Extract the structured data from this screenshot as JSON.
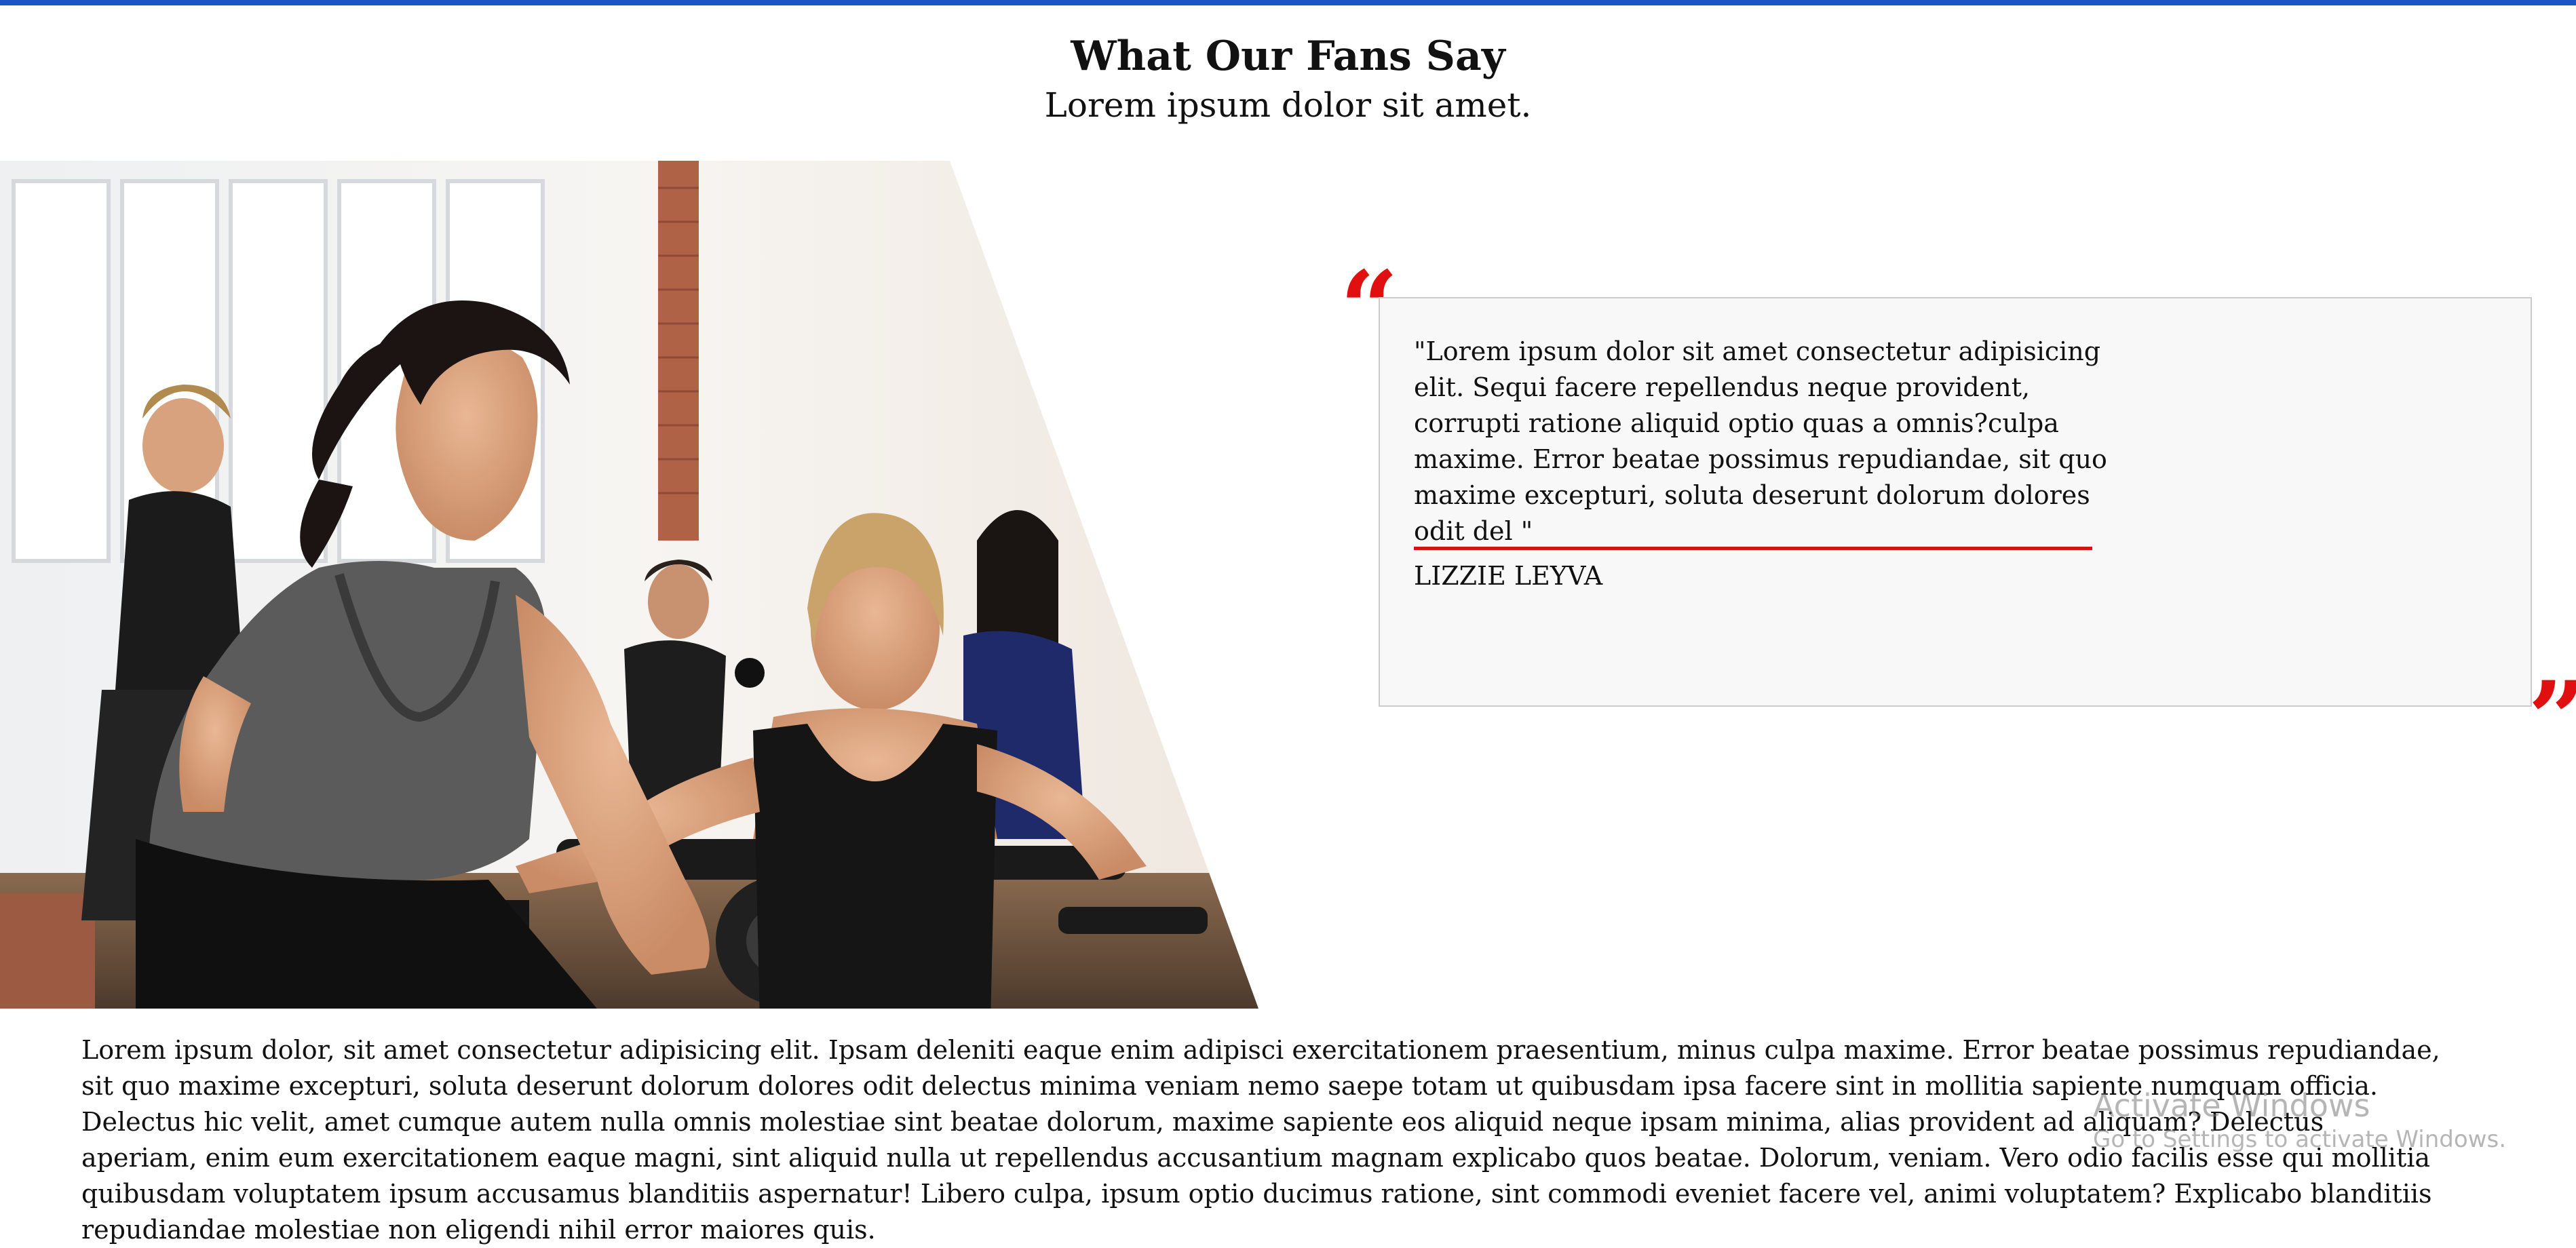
{
  "colors": {
    "accent_bar": "#1a56c4",
    "quote_mark": "#e01010",
    "rule": "#d11414",
    "card_bg": "#f8f8f8",
    "card_border": "#cccccc"
  },
  "header": {
    "title": "What Our Fans Say",
    "subtitle": "Lorem ipsum dolor sit amet."
  },
  "hero_image": {
    "description": "Women smiling and riding indoor cycling bikes in a fitness studio",
    "icon": "photo"
  },
  "testimonial": {
    "open_quote": "“",
    "close_quote": "”",
    "text": "\"Lorem ipsum dolor sit amet consectetur adipisicing elit. Sequi facere repellendus neque provident, corrupti ratione aliquid optio quas a omnis?culpa maxime. Error beatae possimus repudiandae, sit quo maxime excepturi, soluta deserunt dolorum dolores odit del \"",
    "author": "LIZZIE LEYVA"
  },
  "body": {
    "paragraph": "Lorem ipsum dolor, sit amet consectetur adipisicing elit. Ipsam deleniti eaque enim adipisci exercitationem praesentium, minus culpa maxime. Error beatae possimus repudiandae, sit quo maxime excepturi, soluta deserunt dolorum dolores odit delectus minima veniam nemo saepe totam ut quibusdam ipsa facere sint in mollitia sapiente numquam officia. Delectus hic velit, amet cumque autem nulla omnis molestiae sint beatae dolorum, maxime sapiente eos aliquid neque ipsam minima, alias provident ad aliquam? Delectus aperiam, enim eum exercitationem eaque magni, sint aliquid nulla ut repellendus accusantium magnam explicabo quos beatae. Dolorum, veniam. Vero odio facilis esse qui mollitia quibusdam voluptatem ipsum accusamus blanditiis aspernatur! Libero culpa, ipsum optio ducimus ratione, sint commodi eveniet facere vel, animi voluptatem? Explicabo blanditiis repudiandae molestiae non eligendi nihil error maiores quis."
  },
  "watermark": {
    "title": "Activate Windows",
    "subtitle": "Go to Settings to activate Windows."
  }
}
